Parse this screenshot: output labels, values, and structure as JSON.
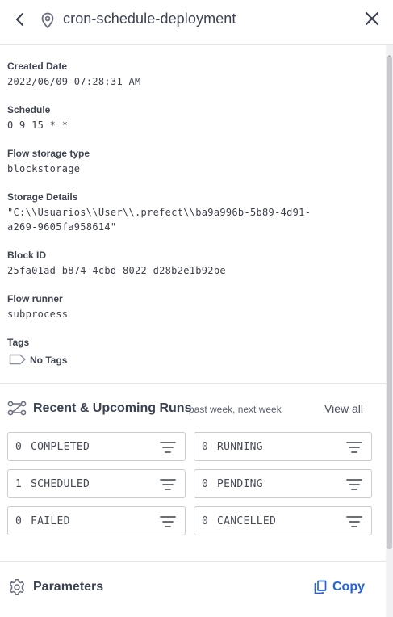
{
  "header": {
    "title": "cron-schedule-deployment",
    "back_icon": "chevron-left-icon",
    "location_icon": "map-pin-icon",
    "close_icon": "close-icon"
  },
  "details": [
    {
      "label": "Created Date",
      "value": "2022/06/09 07:28:31 AM"
    },
    {
      "label": "Schedule",
      "value": "0 9 15 * *"
    },
    {
      "label": "Flow storage type",
      "value": "blockstorage"
    },
    {
      "label": "Storage Details",
      "value": "\"C:\\\\Usuarios\\\\User\\\\.prefect\\\\ba9a996b-5b89-4d91-\na269-9605fa958614\""
    },
    {
      "label": "Block ID",
      "value": "25fa01ad-b874-4cbd-8022-d28b2e1b92be"
    },
    {
      "label": "Flow runner",
      "value": "subprocess"
    }
  ],
  "tags": {
    "label": "Tags",
    "empty_text": "No Tags",
    "icon": "tag-icon"
  },
  "runs": {
    "title": "Recent & Upcoming Runs",
    "subtitle": "past week, next week",
    "view_all": "View all",
    "icon": "flow-runs-icon",
    "states": [
      {
        "count": "0",
        "name": "COMPLETED"
      },
      {
        "count": "0",
        "name": "RUNNING"
      },
      {
        "count": "1",
        "name": "SCHEDULED"
      },
      {
        "count": "0",
        "name": "PENDING"
      },
      {
        "count": "0",
        "name": "FAILED"
      },
      {
        "count": "0",
        "name": "CANCELLED"
      }
    ]
  },
  "parameters": {
    "title": "Parameters",
    "copy_label": "Copy",
    "icon": "gear-icon"
  },
  "colors": {
    "accent": "#2563d8",
    "text": "#3b4252",
    "border": "#c9ccd3"
  }
}
